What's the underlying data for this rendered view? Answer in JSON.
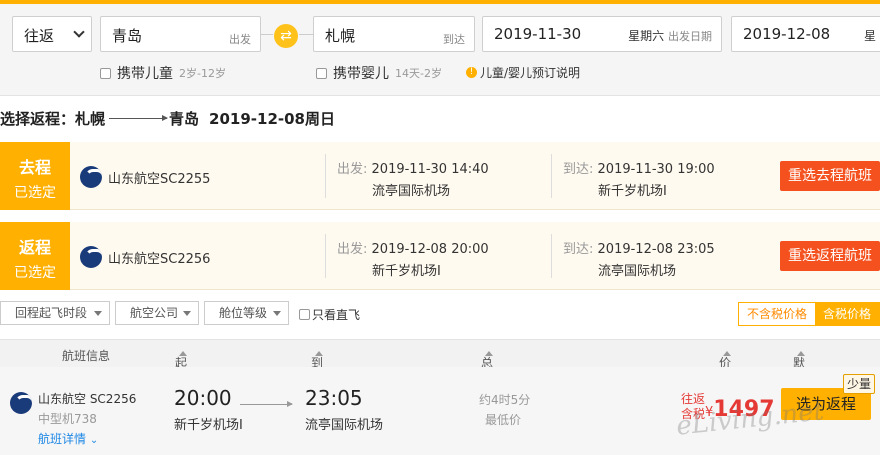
{
  "search": {
    "trip_type": "往返",
    "from_city": "青岛",
    "from_hint": "出发",
    "to_city": "札幌",
    "to_hint": "到达",
    "depart_date": "2019-11-30",
    "depart_weekday": "星期六",
    "depart_hint": "出发日期",
    "return_date": "2019-12-08",
    "return_weekday_partial": "星",
    "child_label": "携带儿童",
    "child_age": "2岁-12岁",
    "infant_label": "携带婴儿",
    "infant_age": "14天-2岁",
    "info_label": "儿童/婴儿预订说明"
  },
  "heading": {
    "prefix": "选择返程：札幌",
    "dest": "青岛",
    "date": "2019-12-08周日"
  },
  "outbound": {
    "tag_line1": "去程",
    "tag_line2": "已选定",
    "airline": "山东航空SC2255",
    "dep_label": "出发:",
    "dep_time": "2019-11-30 14:40",
    "dep_airport": "流亭国际机场",
    "arr_label": "到达:",
    "arr_time": "2019-11-30 19:00",
    "arr_airport": "新千岁机场I",
    "button": "重选去程航班"
  },
  "return": {
    "tag_line1": "返程",
    "tag_line2": "已选定",
    "airline": "山东航空SC2256",
    "dep_label": "出发:",
    "dep_time": "2019-12-08 20:00",
    "dep_airport": "新千岁机场I",
    "arr_label": "到达:",
    "arr_time": "2019-12-08 23:05",
    "arr_airport": "流亭国际机场",
    "button": "重选返程航班"
  },
  "filters": {
    "dep_period": "回程起飞时段",
    "airline": "航空公司",
    "cabin": "舱位等级",
    "direct": "只看直飞",
    "price_excl": "不含税价格",
    "price_incl": "含税价格"
  },
  "table": {
    "col_flight": "航班信息",
    "col_dep": "起飞时间",
    "col_arr": "到达时间",
    "col_duration": "总耗时",
    "col_price": "价格",
    "col_sort": "默认排序"
  },
  "flight": {
    "airline": "山东航空 SC2256",
    "aircraft": "中型机738",
    "details": "航班详情",
    "dep_time": "20:00",
    "dep_airport": "新千岁机场I",
    "arr_time": "23:05",
    "arr_airport": "流亭国际机场",
    "duration": "约4时5分",
    "lowest": "最低价",
    "price_tag1": "往返",
    "price_tag2": "含税",
    "currency": "¥",
    "price": "1497",
    "select_button": "选为返程",
    "badge": "少量"
  },
  "watermark": "eLiving.net",
  "colors": {
    "accent": "#ffb000",
    "button_red": "#f4511e",
    "price_red": "#e53935"
  }
}
